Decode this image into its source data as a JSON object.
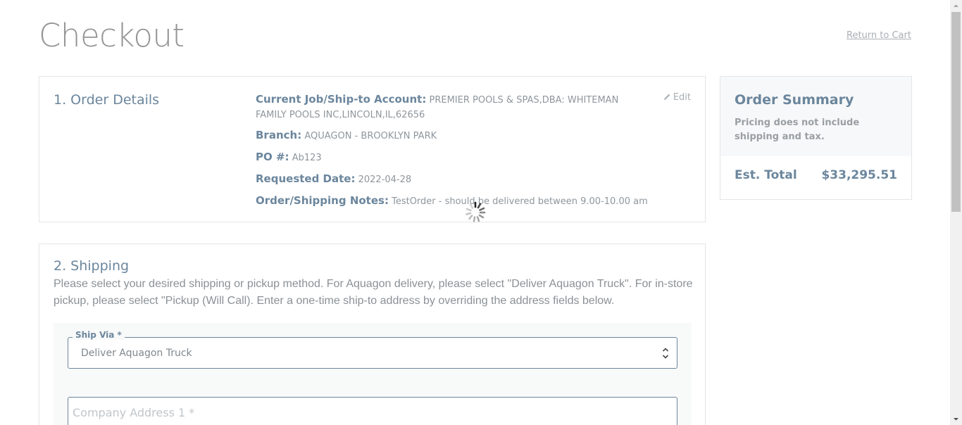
{
  "page": {
    "title": "Checkout",
    "return_link": "Return to Cart"
  },
  "order_details": {
    "heading": "1. Order Details",
    "edit_label": "Edit",
    "rows": [
      {
        "label": "Current Job/Ship-to Account:",
        "value": "PREMIER POOLS & SPAS,DBA: WHITEMAN FAMILY POOLS INC,LINCOLN,IL,62656"
      },
      {
        "label": "Branch:",
        "value": "AQUAGON - BROOKLYN PARK"
      },
      {
        "label": "PO #:",
        "value": "Ab123"
      },
      {
        "label": "Requested Date:",
        "value": "2022-04-28"
      },
      {
        "label": "Order/Shipping Notes:",
        "value": "TestOrder - should be delivered between 9.00-10.00 am"
      }
    ]
  },
  "summary": {
    "title": "Order Summary",
    "note": "Pricing does not include shipping and tax.",
    "total_label": "Est. Total",
    "total_value": "$33,295.51"
  },
  "shipping": {
    "heading": "2. Shipping",
    "description": "Please select your desired shipping or pickup method. For Aquagon delivery, please select \"Deliver Aquagon Truck\". For in-store pickup, please select \"Pickup (Will Call). Enter a one-time ship-to address by overriding the address fields below.",
    "ship_via_label": "Ship Via *",
    "ship_via_value": "Deliver Aquagon Truck",
    "address1_placeholder": "Company Address 1 *"
  },
  "colors": {
    "accent": "#6b869d",
    "muted_text": "#8f969c",
    "panel_border": "#e3e5e7"
  },
  "icons": [
    "pencil-icon",
    "loading-spinner-icon",
    "select-arrows-icon"
  ]
}
